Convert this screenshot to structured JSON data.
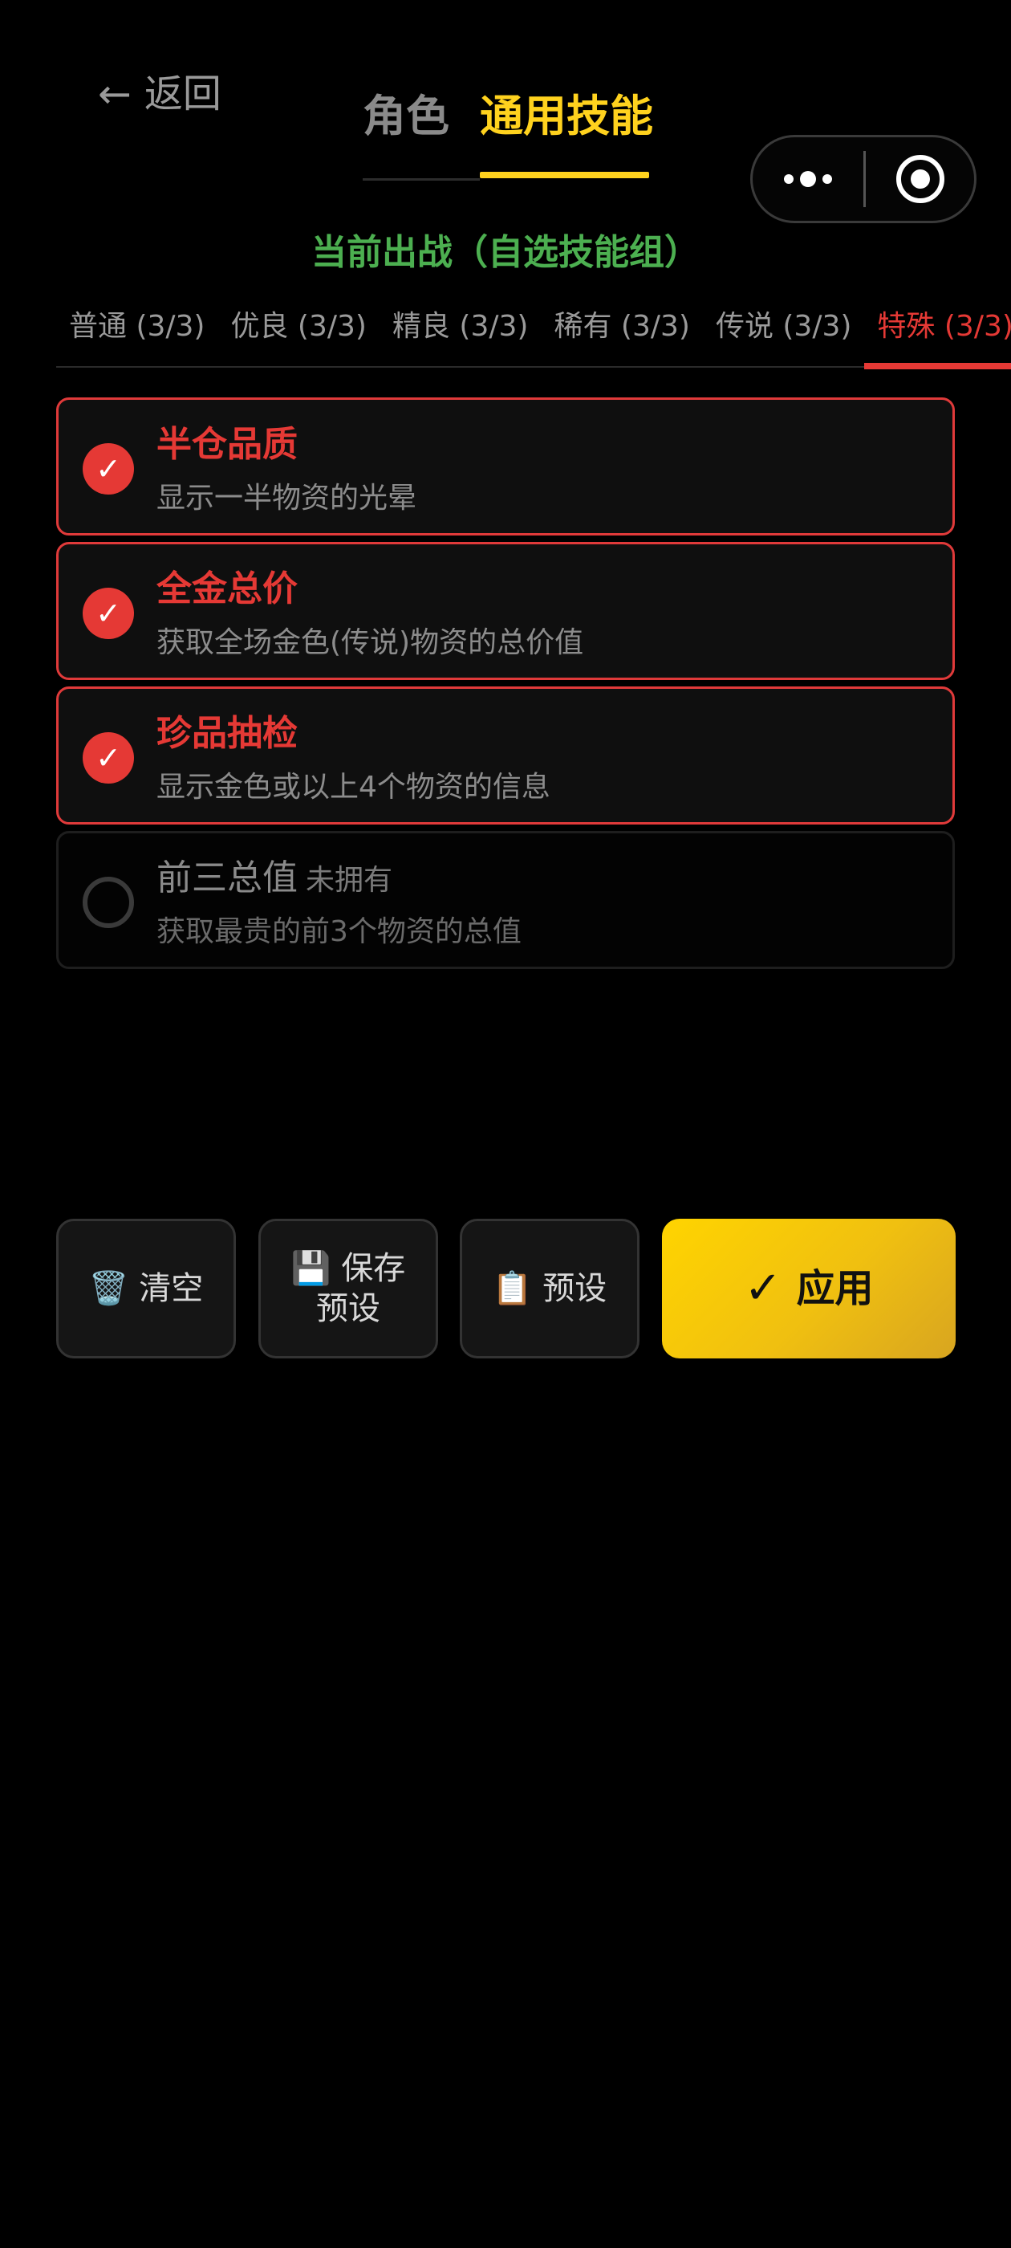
{
  "header": {
    "back_arrow": "←",
    "back_label": "返回",
    "tabs": [
      {
        "label": "角色",
        "active": false
      },
      {
        "label": "通用技能",
        "active": true
      }
    ]
  },
  "subtitle": "当前出战（自选技能组）",
  "rarity_tabs": [
    {
      "label": "普通 (3/3)",
      "active": false
    },
    {
      "label": "优良 (3/3)",
      "active": false
    },
    {
      "label": "精良 (3/3)",
      "active": false
    },
    {
      "label": "稀有 (3/3)",
      "active": false
    },
    {
      "label": "传说 (3/3)",
      "active": false
    },
    {
      "label": "特殊 (3/3)",
      "active": true
    }
  ],
  "skills": [
    {
      "name": "半仓品质",
      "desc": "显示一半物资的光晕",
      "selected": true,
      "check": "✓"
    },
    {
      "name": "全金总价",
      "desc": "获取全场金色(传说)物资的总价值",
      "selected": true,
      "check": "✓"
    },
    {
      "name": "珍品抽检",
      "desc": "显示金色或以上4个物资的信息",
      "selected": true,
      "check": "✓"
    },
    {
      "name": "前三总值",
      "tag": "未拥有",
      "desc": "获取最贵的前3个物资的总值",
      "selected": false
    }
  ],
  "buttons": {
    "clear": {
      "icon": "🗑️",
      "label": "清空"
    },
    "save": {
      "icon": "💾",
      "label": "保存预设"
    },
    "preset": {
      "icon": "📋",
      "label": "预设"
    },
    "apply": {
      "icon": "✓",
      "label": "应用"
    }
  },
  "colors": {
    "accent_yellow": "#ffd21e",
    "accent_red": "#e53935",
    "accent_green": "#4caf50",
    "background": "#000000"
  }
}
